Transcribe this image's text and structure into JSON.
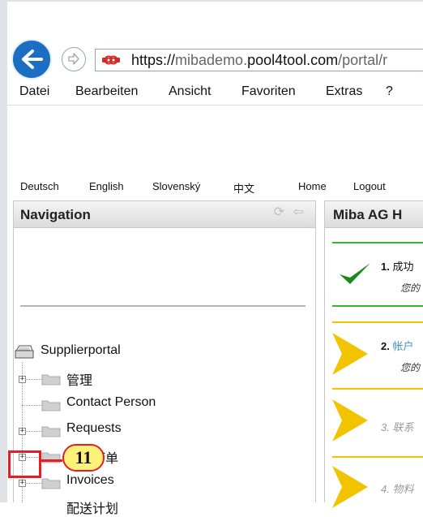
{
  "browser": {
    "url_scheme": "https://",
    "url_host_pre": "mibademo.",
    "url_host": "pool4tool.com",
    "url_path": "/portal/r"
  },
  "menu": {
    "items": [
      "Datei",
      "Bearbeiten",
      "Ansicht",
      "Favoriten",
      "Extras",
      "?"
    ]
  },
  "languages": [
    "Deutsch",
    "English",
    "Slovenský",
    "中文"
  ],
  "top_links": {
    "home": "Home",
    "logout": "Logout"
  },
  "navigation": {
    "title": "Navigation",
    "tree_root": "Supplierportal",
    "tree_items": [
      "管理",
      "Contact Person",
      "Requests",
      "我的订单",
      "Invoices",
      "配送计划"
    ]
  },
  "right_panel": {
    "title": "Miba AG H",
    "steps": [
      {
        "num": "1.",
        "title": "成功",
        "subtitle": "您的"
      },
      {
        "num": "2.",
        "title": "帐户",
        "subtitle": "您的"
      },
      {
        "num": "3.",
        "title": "联系"
      },
      {
        "num": "4.",
        "title": "物料"
      }
    ]
  },
  "annotation": {
    "number": "11",
    "color": "#e31e24",
    "bubble_color": "#fff27a"
  },
  "colors": {
    "browser_accent": "#1b6ec2",
    "success": "#36b82e",
    "pending": "#f2c400",
    "link": "#4a8fd6"
  }
}
